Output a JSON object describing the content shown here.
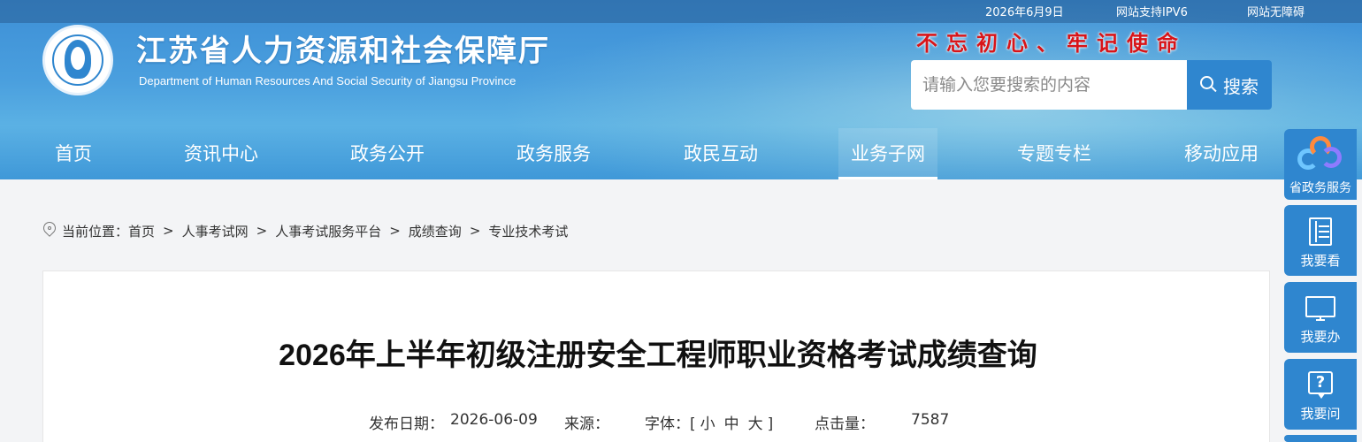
{
  "topbar": {
    "date": "2026年6月9日",
    "ipv6": "网站支持IPV6",
    "accessible": "网站无障碍"
  },
  "header": {
    "title": "江苏省人力资源和社会保障厅",
    "subtitle": "Department of Human Resources And Social Security of Jiangsu Province",
    "slogan": "不忘初心、牢记使命"
  },
  "search": {
    "placeholder": "请输入您要搜索的内容",
    "button_label": "搜索"
  },
  "nav": {
    "items": [
      "首页",
      "资讯中心",
      "政务公开",
      "政务服务",
      "政民互动",
      "业务子网",
      "专题专栏",
      "移动应用"
    ],
    "active": "业务子网"
  },
  "breadcrumb": {
    "prefix": "当前位置：",
    "items": [
      "首页",
      "人事考试网",
      "人事考试服务平台",
      "成绩查询",
      "专业技术考试"
    ],
    "separator": ">"
  },
  "article": {
    "title": "2026年上半年初级注册安全工程师职业资格考试成绩查询",
    "publish_label": "发布日期：",
    "publish_date": "2026-06-09",
    "source_label": "来源：",
    "source_value": "",
    "font_label": "字体：",
    "font_open": "[",
    "font_small": "小",
    "font_medium": "中",
    "font_large": "大",
    "font_close": "]",
    "views_label": "点击量：",
    "views_value": "7587"
  },
  "float_panel": {
    "items": [
      "省政务服务",
      "我要看",
      "我要办",
      "我要问"
    ]
  },
  "colors": {
    "header_blue": "#3d8fd6",
    "button_blue": "#2f86cf",
    "slogan_red": "#d81418"
  }
}
